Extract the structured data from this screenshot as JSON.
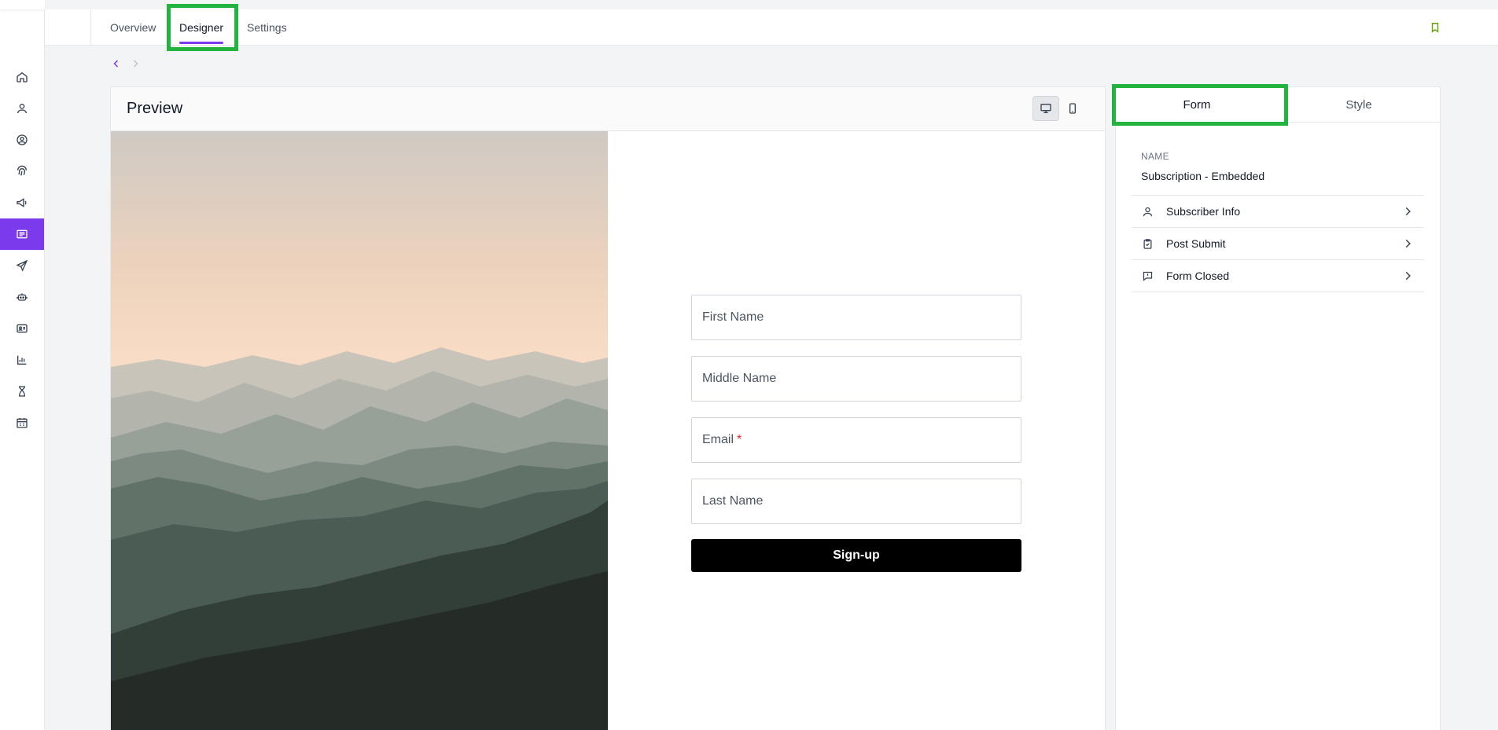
{
  "colors": {
    "accent": "#7c3aed",
    "highlight": "#22b43f",
    "bookmark": "#65a30d"
  },
  "rail": {
    "items": [
      {
        "icon": "home-icon"
      },
      {
        "icon": "user-icon"
      },
      {
        "icon": "contact-circle-icon"
      },
      {
        "icon": "fingerprint-icon"
      },
      {
        "icon": "megaphone-icon"
      },
      {
        "icon": "forms-icon",
        "active": true
      },
      {
        "icon": "send-icon"
      },
      {
        "icon": "robot-icon"
      },
      {
        "icon": "id-card-icon"
      },
      {
        "icon": "chart-icon"
      },
      {
        "icon": "hourglass-icon"
      },
      {
        "icon": "calendar-icon"
      }
    ]
  },
  "tabs": [
    {
      "label": "Overview"
    },
    {
      "label": "Designer",
      "active": true
    },
    {
      "label": "Settings"
    }
  ],
  "preview": {
    "title": "Preview",
    "device_options": [
      "desktop-icon",
      "mobile-icon"
    ],
    "selected_device": "desktop"
  },
  "form": {
    "fields": [
      {
        "label": "First Name",
        "required": false
      },
      {
        "label": "Middle Name",
        "required": false
      },
      {
        "label": "Email",
        "required": true,
        "required_mark": "*"
      },
      {
        "label": "Last Name",
        "required": false
      }
    ],
    "submit_label": "Sign-up"
  },
  "panel": {
    "tabs": [
      {
        "label": "Form",
        "active": true
      },
      {
        "label": "Style"
      }
    ],
    "name_label": "NAME",
    "name_value": "Subscription - Embedded",
    "items": [
      {
        "label": "Subscriber Info",
        "icon": "user-icon"
      },
      {
        "label": "Post Submit",
        "icon": "clipboard-check-icon"
      },
      {
        "label": "Form Closed",
        "icon": "message-alert-icon"
      }
    ]
  }
}
